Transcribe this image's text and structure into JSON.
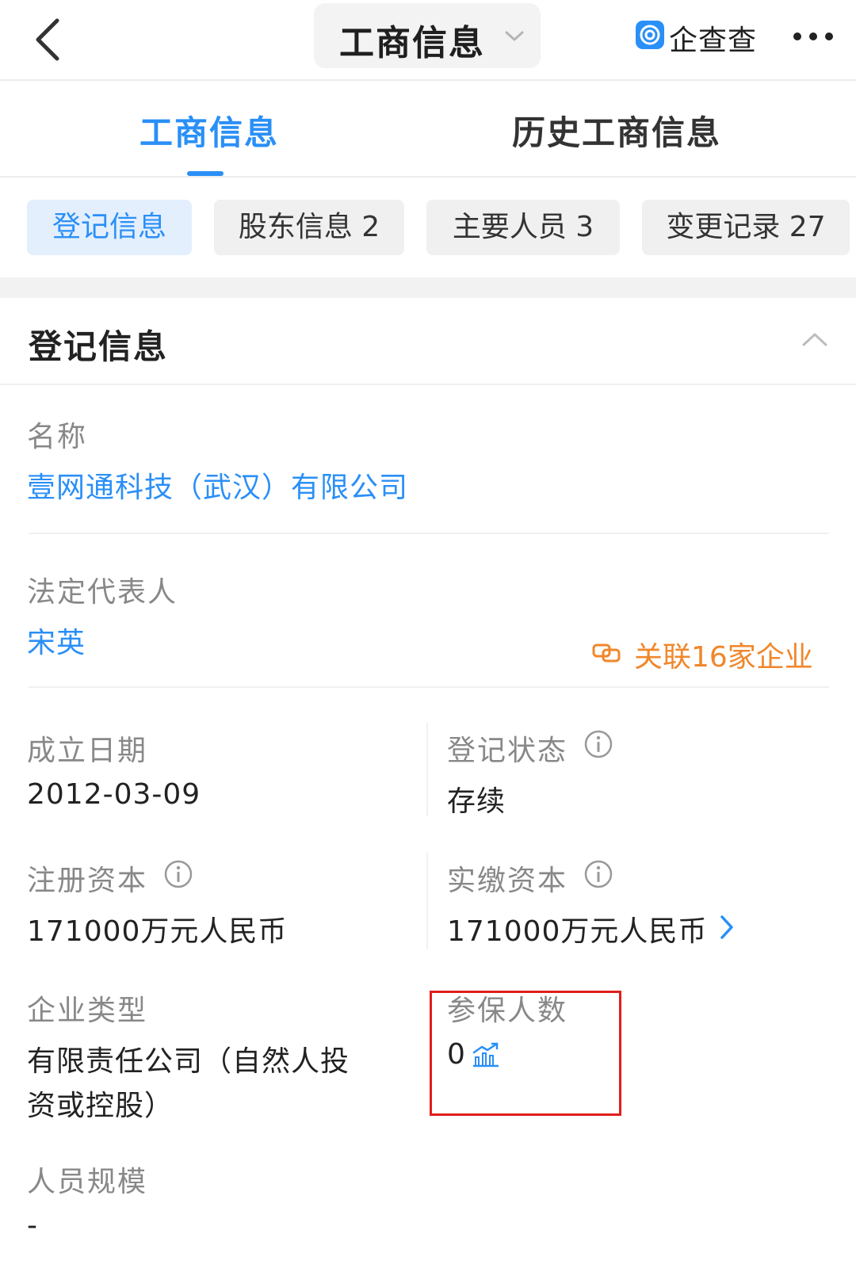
{
  "header": {
    "title": "工商信息",
    "brand_name": "企查查"
  },
  "tabs": [
    {
      "label": "工商信息",
      "active": true
    },
    {
      "label": "历史工商信息",
      "active": false
    }
  ],
  "chips": [
    {
      "label": "登记信息",
      "active": true
    },
    {
      "label": "股东信息 2",
      "active": false
    },
    {
      "label": "主要人员 3",
      "active": false
    },
    {
      "label": "变更记录 27",
      "active": false
    }
  ],
  "section": {
    "title": "登记信息"
  },
  "fields": {
    "name": {
      "label": "名称",
      "value": "壹网通科技（武汉）有限公司"
    },
    "legal_rep": {
      "label": "法定代表人",
      "value": "宋英",
      "related": "关联16家企业"
    },
    "founded": {
      "label": "成立日期",
      "value": "2012-03-09"
    },
    "status": {
      "label": "登记状态",
      "value": "存续"
    },
    "registered_capital": {
      "label": "注册资本",
      "value": "171000万元人民币"
    },
    "paid_capital": {
      "label": "实缴资本",
      "value": "171000万元人民币"
    },
    "company_type": {
      "label": "企业类型",
      "value_line1": "有限责任公司（自然人投",
      "value_line2": "资或控股）"
    },
    "insured": {
      "label": "参保人数",
      "value": "0"
    },
    "staff_size": {
      "label": "人员规模",
      "value": "-"
    }
  },
  "colors": {
    "accent": "#2a8ff7",
    "orange": "#f0872b",
    "highlight": "#e01e1e"
  }
}
